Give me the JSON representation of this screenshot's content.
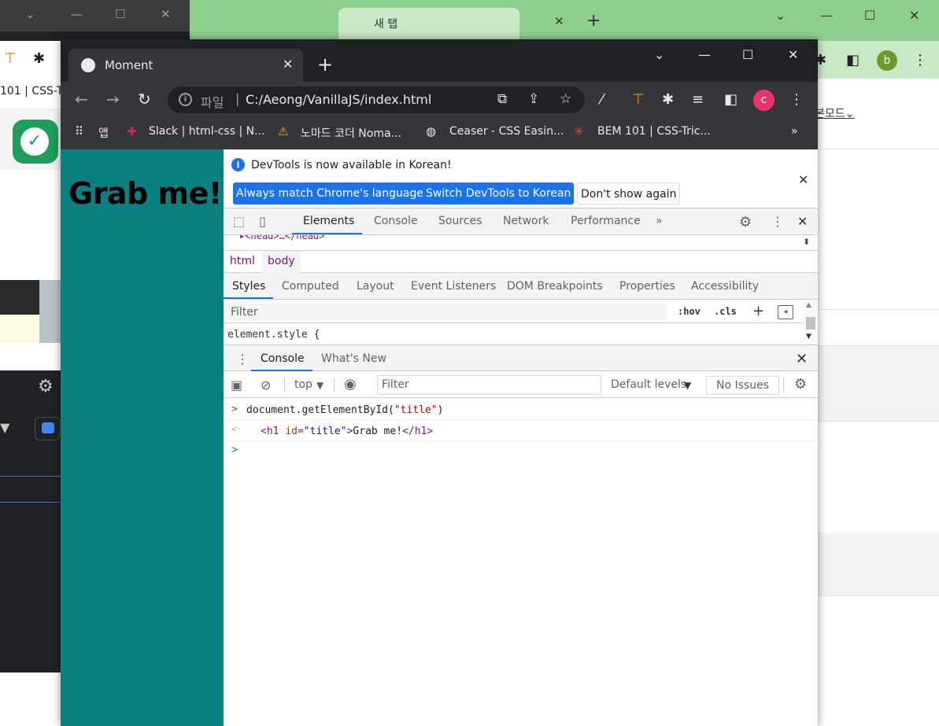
{
  "bg_green_window": {
    "tab_title": "새 탭",
    "korean_mode_text": "본모드⌄"
  },
  "bg_dark_window": {
    "bookmark_text": "101 | CSS-T"
  },
  "browser": {
    "tab_title": "Moment",
    "url_scheme": "파일",
    "url": "C:/Aeong/VanillaJS/index.html",
    "profile_initial": "c",
    "bg_profile_initial": "b",
    "bookmarks": [
      {
        "label": "앱"
      },
      {
        "label": "Slack | html-css | N..."
      },
      {
        "label": "노마드 코더 Noma..."
      },
      {
        "label": "Ceaser - CSS Easin..."
      },
      {
        "label": "BEM 101 | CSS-Tric..."
      }
    ],
    "bookmarks_overflow": "»"
  },
  "page": {
    "heading": "Grab me!",
    "background_color": "#0a8080"
  },
  "devtools": {
    "infobar": {
      "message": "DevTools is now available in Korean!",
      "btn_match": "Always match Chrome's language",
      "btn_switch": "Switch DevTools to Korean",
      "btn_dont_show": "Don't show again"
    },
    "main_tabs": [
      "Elements",
      "Console",
      "Sources",
      "Network",
      "Performance"
    ],
    "main_tabs_overflow": "»",
    "dom_head_line": "▸<head>…</head>",
    "breadcrumbs": [
      "html",
      "body"
    ],
    "styles_tabs": [
      "Styles",
      "Computed",
      "Layout",
      "Event Listeners",
      "DOM Breakpoints",
      "Properties",
      "Accessibility"
    ],
    "styles_filter_placeholder": "Filter",
    "hov_label": ":hov",
    "cls_label": ".cls",
    "element_style": "element.style {",
    "drawer_tabs": [
      "Console",
      "What's New"
    ],
    "console_toolbar": {
      "context": "top",
      "filter_placeholder": "Filter",
      "levels": "Default levels",
      "issues": "No Issues"
    },
    "console_lines": {
      "input_prefix": "document.getElementById(",
      "input_string": "\"title\"",
      "input_suffix": ")",
      "output_open": "<h1",
      "output_attr": "id",
      "output_eq": "=",
      "output_val": "\"title\"",
      "output_close": ">",
      "output_text": "Grab me!",
      "output_end": "</h1>"
    }
  },
  "colors": {
    "accent_blue": "#1a73e8",
    "teal_page": "#0a8080",
    "profile_pink": "#e8336d",
    "profile_green": "#6d9b2a"
  }
}
